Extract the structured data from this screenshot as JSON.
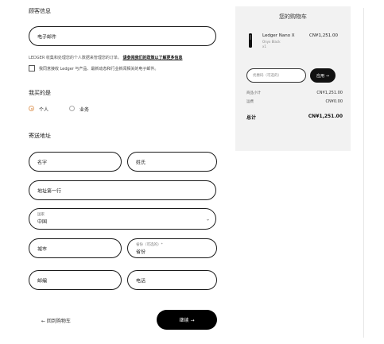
{
  "customer": {
    "heading": "顾客信息",
    "email_placeholder": "电子邮件",
    "privacy_text": "LEDGER 收集和处理您的个人数据来管理您的订单。",
    "privacy_link": "请参阅我们的政策以了解更多信息",
    "newsletter_label": "我同意接收 Ledger 与产品、最新动态和行业新闻相关的电子邮件。"
  },
  "purchase_as": {
    "heading": "我买的是",
    "options": [
      {
        "label": "个人",
        "selected": true
      },
      {
        "label": "业务",
        "selected": false
      }
    ]
  },
  "shipping": {
    "heading": "寄送地址",
    "first_name": "名字",
    "last_name": "姓氏",
    "address_line1": "地址第一行",
    "country_caption": "国家",
    "country_value": "中国",
    "city": "城市",
    "province_caption": "省份（可选的）*",
    "province_value": "省份",
    "postcode": "邮编",
    "phone": "电话"
  },
  "actions": {
    "back_label": "← 回到购物车",
    "continue_label": "继续 →"
  },
  "cart": {
    "title": "您的购物车",
    "product": {
      "name": "Ledger Nano X",
      "color": "Onyx Black",
      "qty": "x1",
      "price": "CN¥1,251.00"
    },
    "promo_placeholder": "优惠码（可选的）",
    "apply_label": "应用 →",
    "subtotal_label": "商品小计",
    "subtotal_value": "CN¥1,251.00",
    "shipping_label": "运费",
    "shipping_value": "CN¥0.00",
    "total_label": "总计",
    "total_value": "CN¥1,251.00"
  },
  "colors": {
    "accent": "#e2a36b",
    "button": "#000000",
    "panel": "#f2f2f2"
  }
}
